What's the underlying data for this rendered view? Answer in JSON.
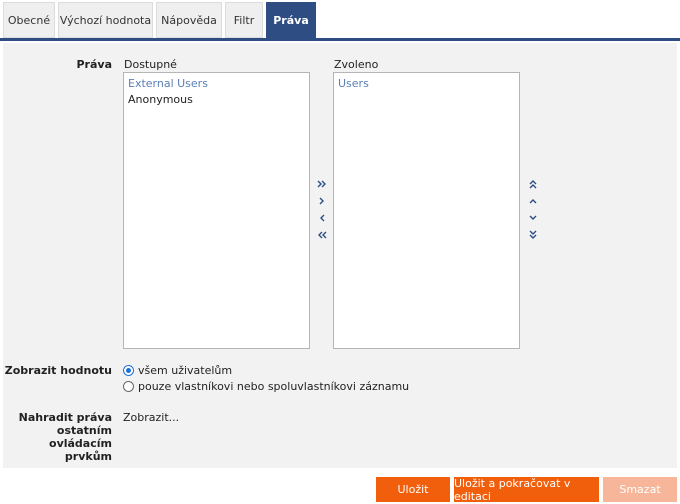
{
  "tabs": [
    {
      "label": "Obecné",
      "active": false
    },
    {
      "label": "Výchozí hodnota",
      "active": false
    },
    {
      "label": "Nápověda",
      "active": false
    },
    {
      "label": "Filtr",
      "active": false
    },
    {
      "label": "Práva",
      "active": true
    }
  ],
  "rights": {
    "label": "Práva",
    "available_title": "Dostupné",
    "selected_title": "Zvoleno",
    "available_items": [
      {
        "label": "External Users",
        "highlighted": true
      },
      {
        "label": "Anonymous",
        "highlighted": false
      }
    ],
    "selected_items": [
      {
        "label": "Users",
        "highlighted": true
      }
    ],
    "transfer_icons": [
      "move-all-right-icon",
      "move-right-icon",
      "move-left-icon",
      "move-all-left-icon"
    ],
    "order_icons": [
      "move-top-icon",
      "move-up-icon",
      "move-down-icon",
      "move-bottom-icon"
    ]
  },
  "show_value": {
    "label": "Zobrazit hodnotu",
    "options": [
      {
        "label": "všem uživatelům",
        "checked": true
      },
      {
        "label": "pouze vlastníkovi nebo spoluvlastníkovi záznamu",
        "checked": false
      }
    ]
  },
  "replace_rights": {
    "label_lines": [
      "Nahradit práva",
      "ostatním",
      "ovládacím",
      "prvkům"
    ],
    "link": "Zobrazit..."
  },
  "footer": {
    "save_label": "Uložit",
    "save_continue_label": "Uložit a pokračovat v editaci",
    "delete_label": "Smazat"
  },
  "colors": {
    "accent": "#2e4e83",
    "button": "#f25f0c",
    "button_disabled": "#f7b69a",
    "selected_item": "#5a7fb5"
  }
}
